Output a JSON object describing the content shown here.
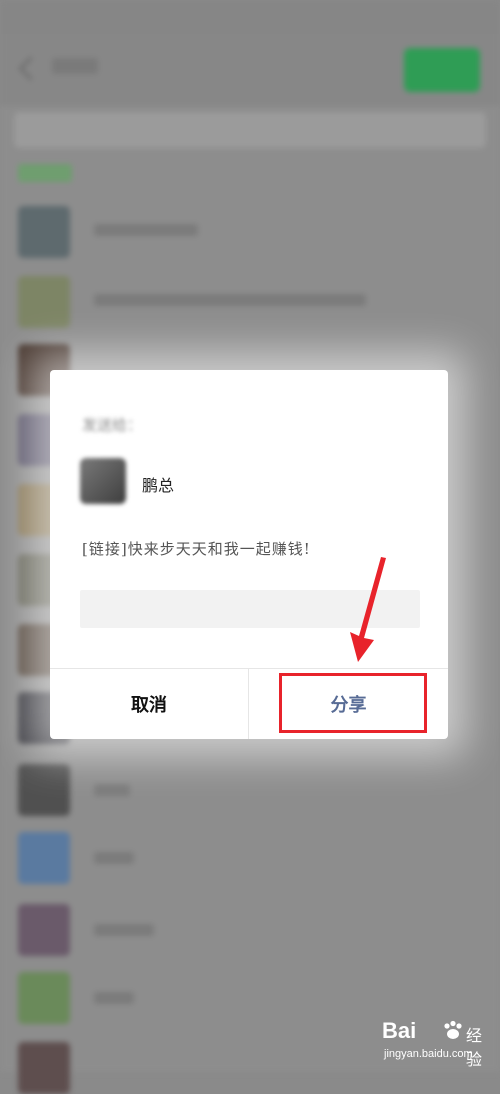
{
  "dialog": {
    "title": "发送给：",
    "recipient_name": "鹏总",
    "link_text": "[链接]快来步天天和我一起赚钱!",
    "cancel_label": "取消",
    "share_label": "分享"
  },
  "watermark": {
    "brand_text": "Bai",
    "brand_suffix": "经验",
    "url": "jingyan.baidu.com"
  },
  "colors": {
    "highlight": "#e8232b",
    "share_text": "#576b95",
    "wechat_green": "#2f9d55"
  }
}
